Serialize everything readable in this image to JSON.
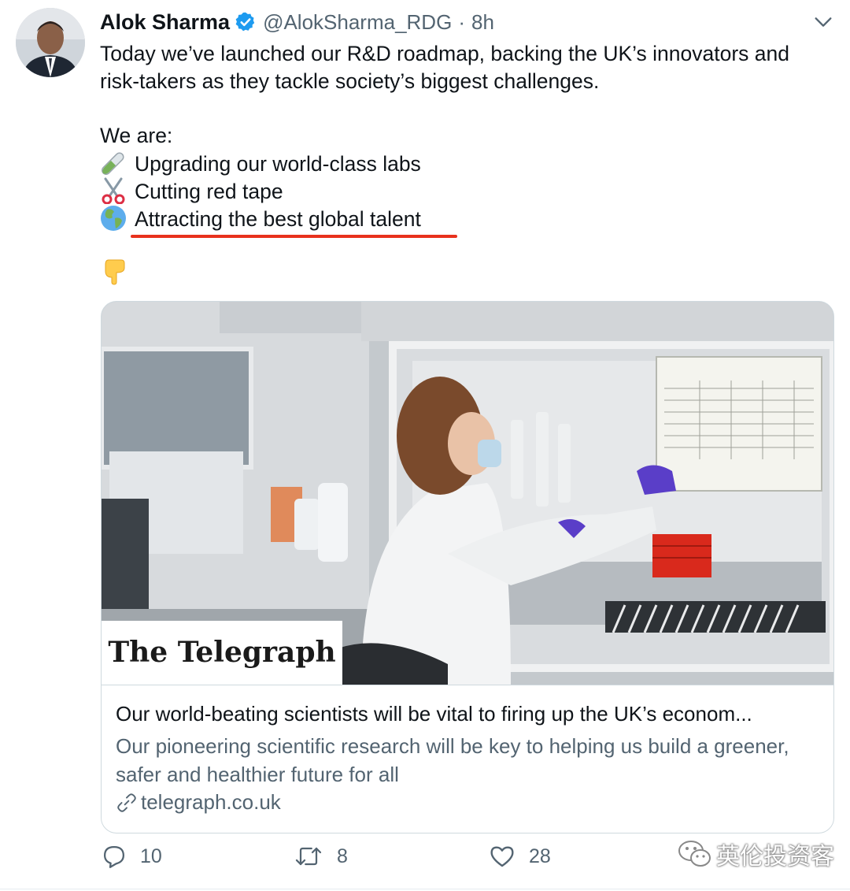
{
  "tweet": {
    "author_name": "Alok Sharma",
    "handle": "@AlokSharma_RDG",
    "separator": "·",
    "time": "8h",
    "lines": [
      "Today we’ve launched our R&D roadmap, backing the UK’s innovators and",
      "risk-takers as they tackle society’s biggest challenges.",
      "We are:"
    ],
    "list_items": [
      {
        "icon": "test-tube-icon",
        "text": "Upgrading our world-class labs"
      },
      {
        "icon": "scissors-icon",
        "text": "Cutting red tape"
      },
      {
        "icon": "globe-icon",
        "text": "Attracting the best global talent"
      }
    ],
    "pointer_emoji": "👇"
  },
  "card": {
    "image_logo": "The Telegraph",
    "title": "Our world-beating scientists will be vital to firing up the UK’s econom...",
    "description": "Our pioneering scientific research will be key to helping us build a greener, safer and healthier future for all",
    "domain": "telegraph.co.uk"
  },
  "actions": {
    "reply_count": "10",
    "retweet_count": "8",
    "like_count": "28"
  },
  "watermark": {
    "text": "英伦投资客"
  },
  "colors": {
    "accent_blue": "#1d9bf0",
    "secondary_text": "#536471",
    "underline_red": "#e8311d"
  }
}
